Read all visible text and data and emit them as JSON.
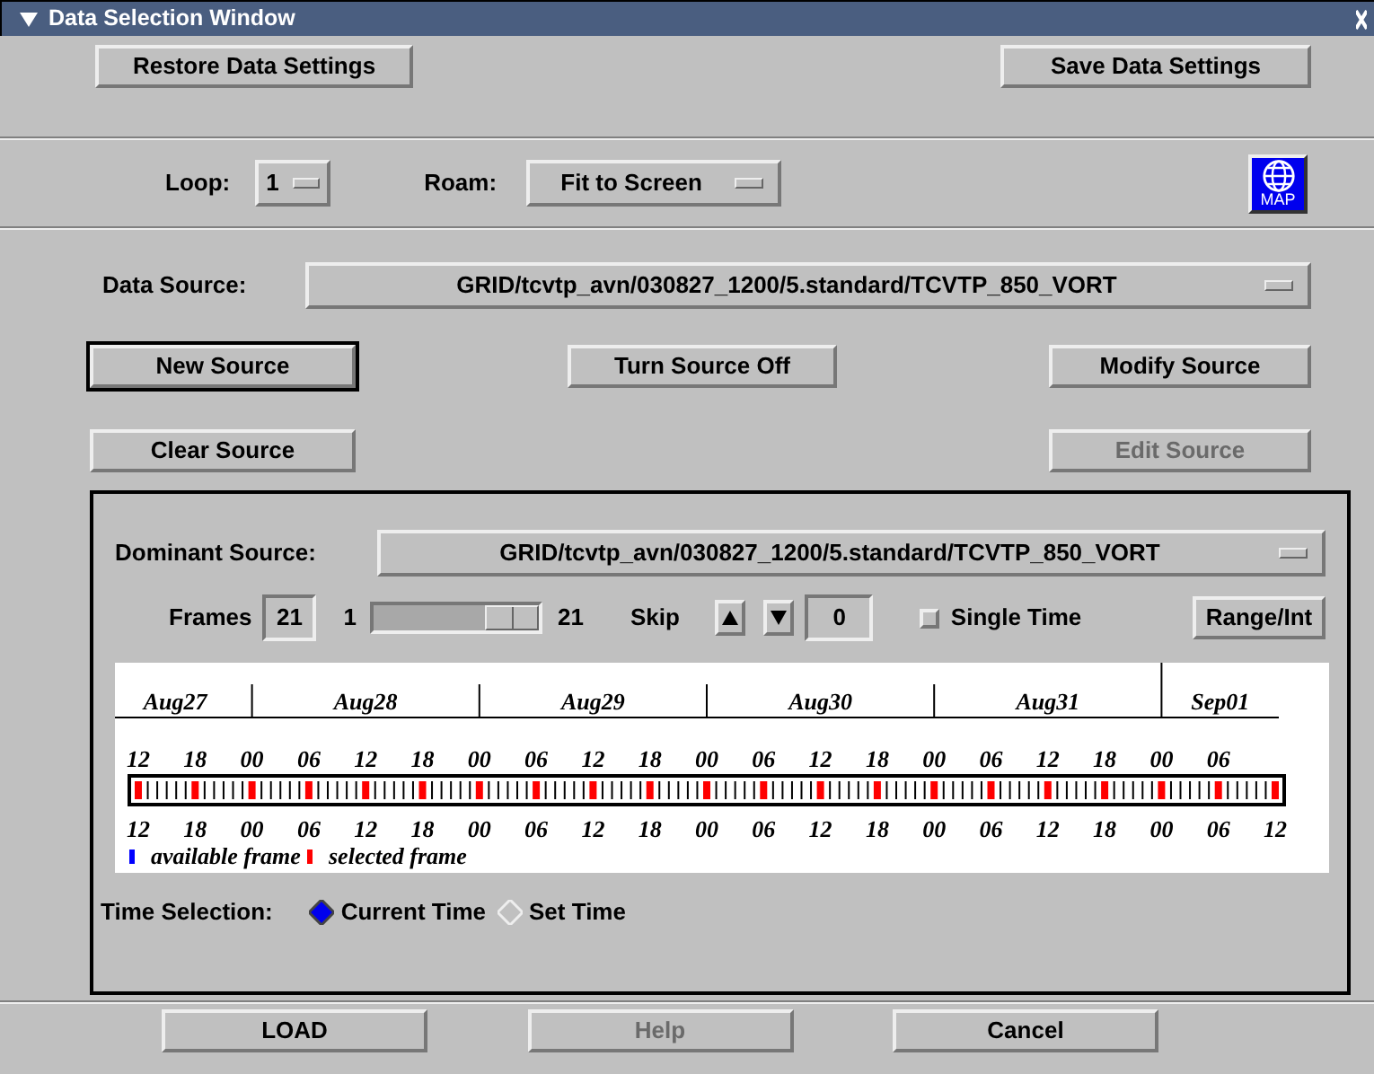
{
  "window": {
    "title": "Data Selection Window"
  },
  "settings_buttons": [
    {
      "label": "Restore Data Settings"
    },
    {
      "label": "Save Data Settings"
    }
  ],
  "loop": {
    "label": "Loop:",
    "value": "1"
  },
  "roam": {
    "label": "Roam:",
    "value": "Fit to Screen"
  },
  "map_button": {
    "label": "MAP"
  },
  "data_source": {
    "label": "Data Source:",
    "value": "GRID/tcvtp_avn/030827_1200/5.standard/TCVTP_850_VORT"
  },
  "source_button_rows": [
    [
      {
        "label": "New Source",
        "disabled": false,
        "default": true
      },
      {
        "label": "Turn Source Off",
        "disabled": false,
        "default": false
      },
      {
        "label": "Modify Source",
        "disabled": false,
        "default": false
      }
    ],
    [
      {
        "label": "Clear Source",
        "disabled": false,
        "default": false
      },
      {
        "label": "Edit Source",
        "disabled": true,
        "default": false
      }
    ]
  ],
  "dominant_source": {
    "label": "Dominant Source:",
    "value": "GRID/tcvtp_avn/030827_1200/5.standard/TCVTP_850_VORT"
  },
  "frames": {
    "label": "Frames",
    "value": "21",
    "min_label": "1",
    "max_label": "21",
    "level": 1
  },
  "skip": {
    "label": "Skip",
    "value": "0"
  },
  "single_time": {
    "label": "Single Time",
    "checked": false
  },
  "range_button": {
    "label": "Range/Int"
  },
  "timeline": {
    "days": [
      "Aug27",
      "Aug28",
      "Aug29",
      "Aug30",
      "Aug31",
      "Sep01"
    ],
    "top_times": [
      "12",
      "18",
      "00",
      "06",
      "12",
      "18",
      "00",
      "06",
      "12",
      "18",
      "00",
      "06",
      "12",
      "18",
      "00",
      "06",
      "12",
      "18",
      "00",
      "06"
    ],
    "bottom_times": [
      "12",
      "18",
      "00",
      "06",
      "12",
      "18",
      "00",
      "06",
      "12",
      "18",
      "00",
      "06",
      "12",
      "18",
      "00",
      "06",
      "12",
      "18",
      "00",
      "06",
      "12"
    ],
    "legend": [
      {
        "label": "available frame",
        "color": "#0000ff"
      },
      {
        "label": "selected frame",
        "color": "#ff0000"
      }
    ]
  },
  "time_selection": {
    "label": "Time Selection:",
    "options": [
      {
        "label": "Current Time",
        "selected": true
      },
      {
        "label": "Set Time",
        "selected": false
      }
    ]
  },
  "bottom_buttons": [
    {
      "label": "LOAD",
      "disabled": false
    },
    {
      "label": "Help",
      "disabled": true
    },
    {
      "label": "Cancel",
      "disabled": false
    }
  ]
}
